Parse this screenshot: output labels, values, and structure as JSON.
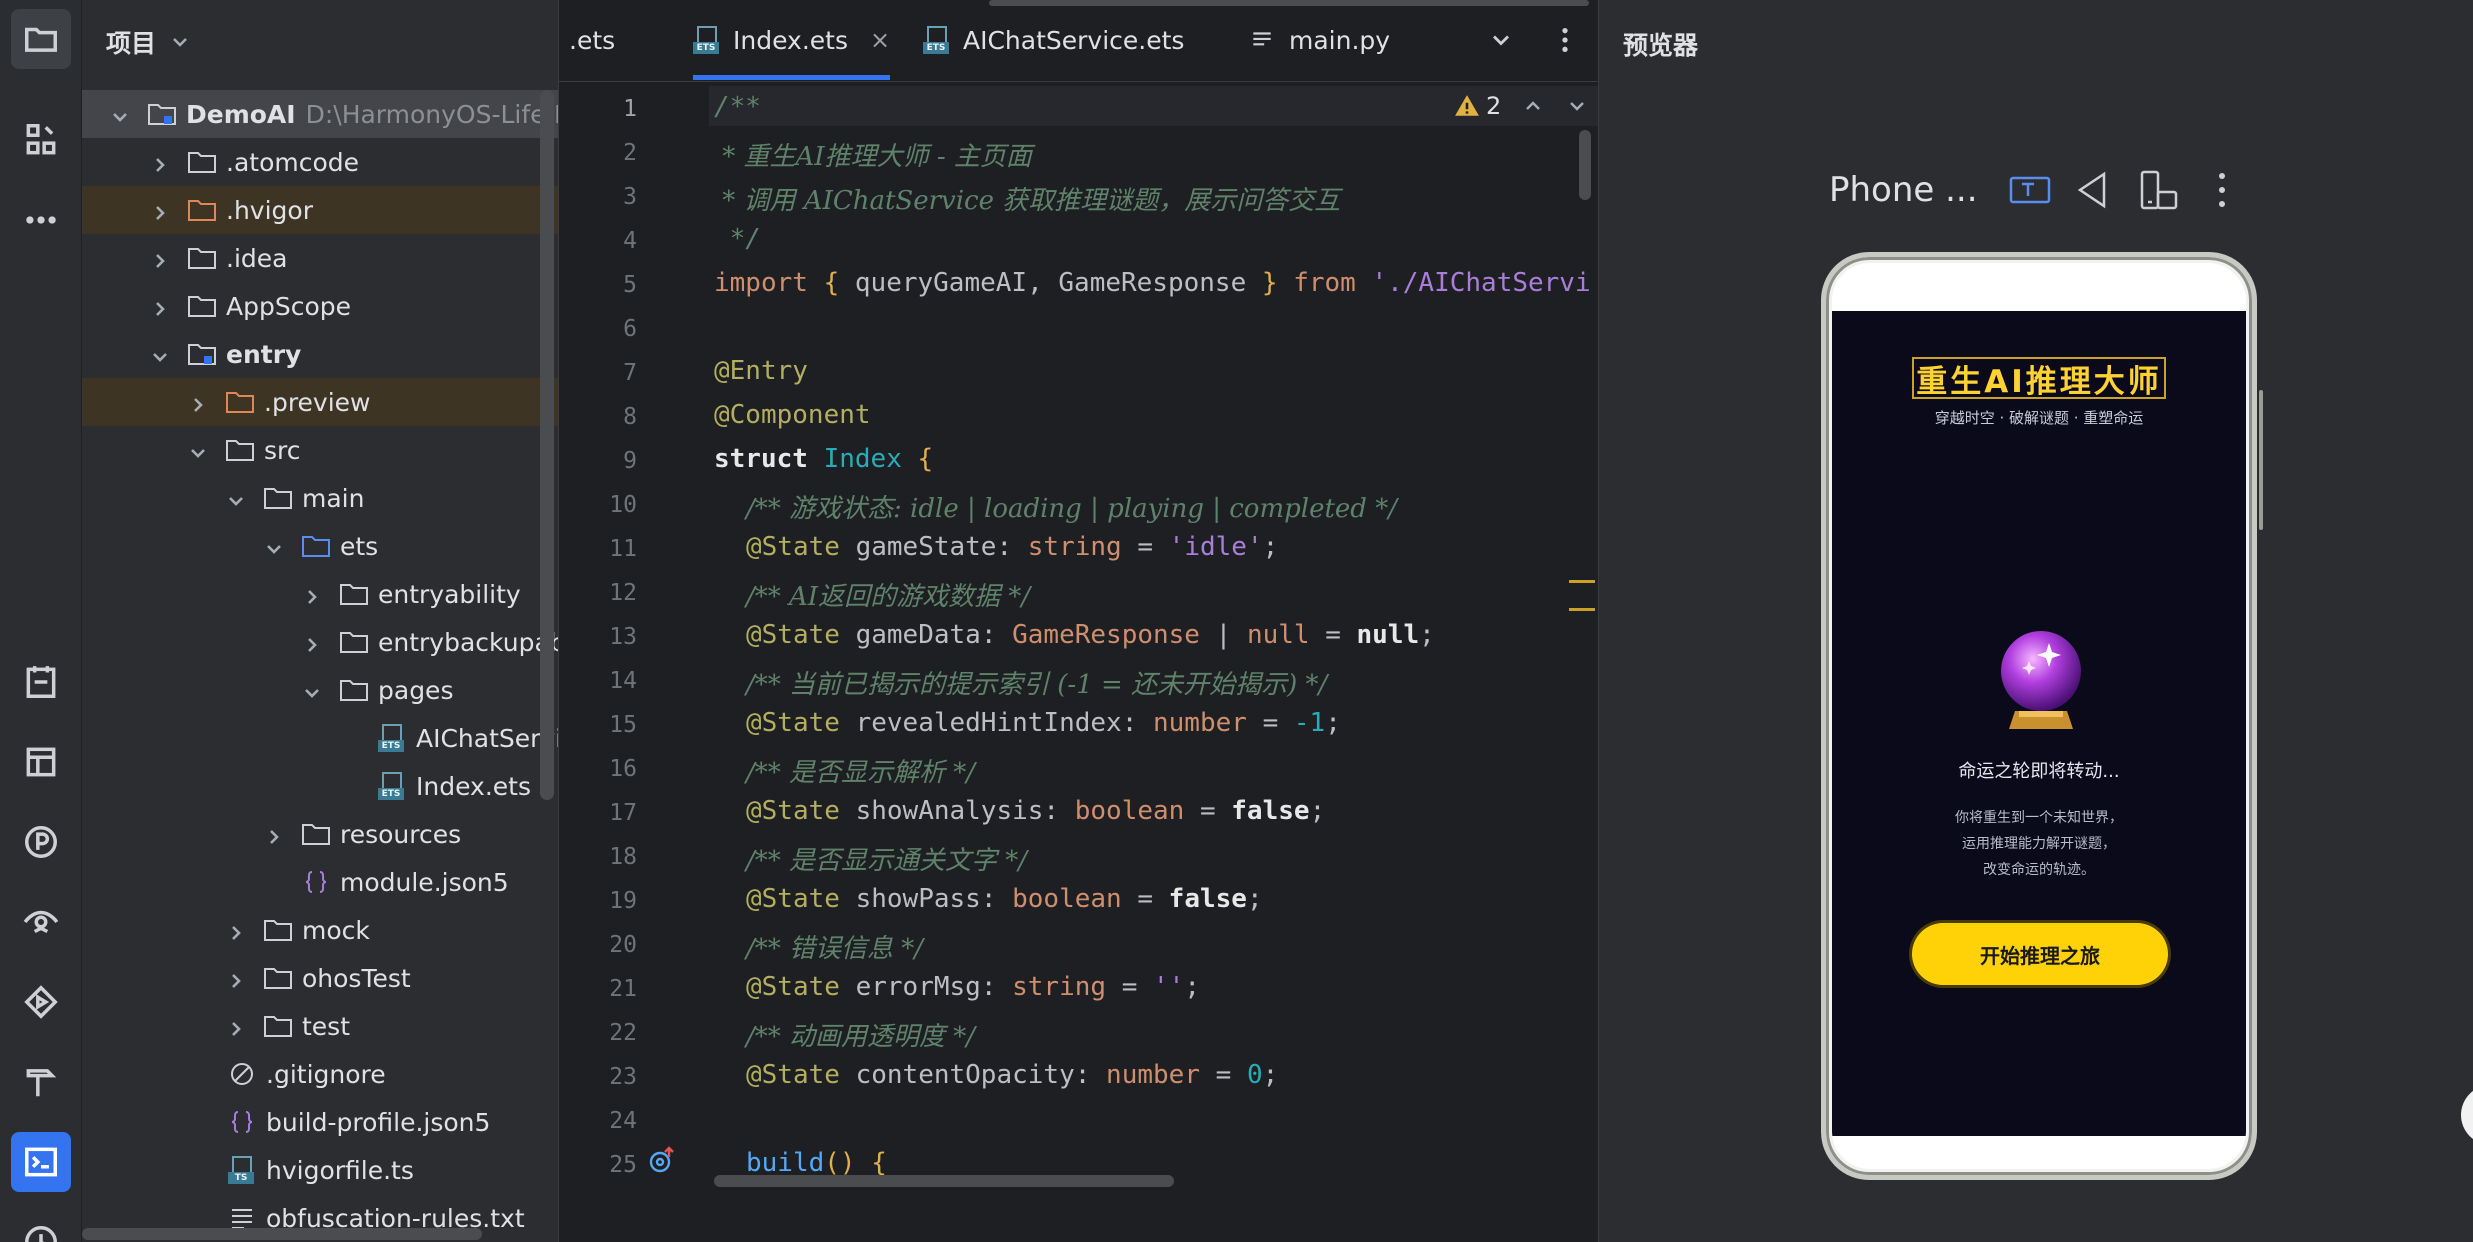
{
  "project_panel": {
    "title": "项目",
    "tree": [
      {
        "label": "DemoAI",
        "path": "D:\\HarmonyOS-Life\\De"
      },
      {
        "label": ".atomcode"
      },
      {
        "label": ".hvigor"
      },
      {
        "label": ".idea"
      },
      {
        "label": "AppScope"
      },
      {
        "label": "entry"
      },
      {
        "label": ".preview"
      },
      {
        "label": "src"
      },
      {
        "label": "main"
      },
      {
        "label": "ets"
      },
      {
        "label": "entryability"
      },
      {
        "label": "entrybackupabil"
      },
      {
        "label": "pages"
      },
      {
        "label": "AIChatServic"
      },
      {
        "label": "Index.ets"
      },
      {
        "label": "resources"
      },
      {
        "label": "module.json5"
      },
      {
        "label": "mock"
      },
      {
        "label": "ohosTest"
      },
      {
        "label": "test"
      },
      {
        "label": ".gitignore"
      },
      {
        "label": "build-profile.json5"
      },
      {
        "label": "hvigorfile.ts"
      },
      {
        "label": "obfuscation-rules.txt"
      }
    ]
  },
  "editor": {
    "tabs": [
      {
        "label": ".ets"
      },
      {
        "label": "Index.ets"
      },
      {
        "label": "AIChatService.ets"
      },
      {
        "label": "main.py"
      }
    ],
    "close_glyph": "×",
    "warning_count": "2",
    "ets_tag": "ETS",
    "ts_tag": "TS",
    "line_numbers": [
      "1",
      "2",
      "3",
      "4",
      "5",
      "6",
      "7",
      "8",
      "9",
      "10",
      "11",
      "12",
      "13",
      "14",
      "15",
      "16",
      "17",
      "18",
      "19",
      "20",
      "21",
      "22",
      "23",
      "24",
      "25"
    ],
    "code": {
      "l1": "/**",
      "l2": " * 重生AI推理大师 - 主页面",
      "l3": " * 调用 AIChatService 获取推理谜题，展示问答交互",
      "l4": " */",
      "l5_import": "import",
      "l5_brace_open": "{",
      "l5_names": " queryGameAI, GameResponse ",
      "l5_brace_close": "}",
      "l5_from": "from",
      "l5_path": "'./AIChatServi",
      "l7": "@Entry",
      "l8": "@Component",
      "l9_kw": "struct",
      "l9_name": "Index",
      "l9_brace": "{",
      "c10": "/** 游戏状态: idle | loading | playing | completed */",
      "s11_ann": "@State",
      "s11_name": "gameState",
      "s11_type": "string",
      "s11_val": "'idle'",
      "c12": "/** AI返回的游戏数据 */",
      "s13_ann": "@State",
      "s13_name": "gameData",
      "s13_type": "GameResponse",
      "s13_null_t": "null",
      "s13_val": "null",
      "c14": "/** 当前已揭示的提示索引 (-1 = 还未开始揭示) */",
      "s15_ann": "@State",
      "s15_name": "revealedHintIndex",
      "s15_type": "number",
      "s15_val": "-1",
      "c16": "/** 是否显示解析 */",
      "s17_ann": "@State",
      "s17_name": "showAnalysis",
      "s17_type": "boolean",
      "s17_val": "false",
      "c18": "/** 是否显示通关文字 */",
      "s19_ann": "@State",
      "s19_name": "showPass",
      "s19_type": "boolean",
      "s19_val": "false",
      "c20": "/** 错误信息 */",
      "s21_ann": "@State",
      "s21_name": "errorMsg",
      "s21_type": "string",
      "s21_val": "''",
      "c22": "/** 动画用透明度 */",
      "s23_ann": "@State",
      "s23_name": "contentOpacity",
      "s23_type": "number",
      "s23_val": "0",
      "l25_fn": "build",
      "l25_parens": "()",
      "l25_brace": "{"
    }
  },
  "previewer": {
    "title": "预览器",
    "device": "Phone ...",
    "app": {
      "title": "重生AI推理大师",
      "subtitle": "穿越时空 · 破解谜题 · 重塑命运",
      "fate_text": "命运之轮即将转动...",
      "intro_lines": [
        "你将重生到一个未知世界，",
        "运用推理能力解开谜题，",
        "改变命运的轨迹。"
      ],
      "start_button": "开始推理之旅"
    }
  },
  "colors": {
    "accent": "#3574f0",
    "app_gold": "#ffd208",
    "app_bg": "#0a0a1a"
  }
}
